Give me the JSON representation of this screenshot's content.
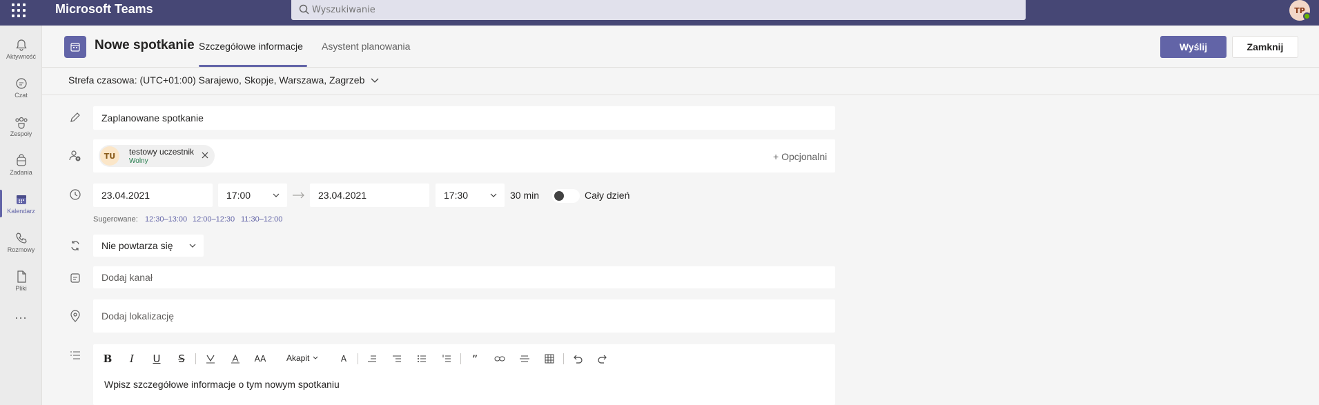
{
  "app": {
    "title": "Microsoft Teams",
    "user_initials": "TP"
  },
  "search": {
    "placeholder": "Wyszukiwanie"
  },
  "rail": {
    "items": [
      {
        "label": "Aktywność",
        "icon": "bell-icon"
      },
      {
        "label": "Czat",
        "icon": "chat-icon"
      },
      {
        "label": "Zespoły",
        "icon": "teams-icon"
      },
      {
        "label": "Zadania",
        "icon": "tasks-icon"
      },
      {
        "label": "Kalendarz",
        "icon": "calendar-icon",
        "active": true
      },
      {
        "label": "Rozmowy",
        "icon": "phone-icon"
      },
      {
        "label": "Pliki",
        "icon": "file-icon"
      }
    ],
    "more": "..."
  },
  "header": {
    "title": "Nowe spotkanie",
    "tabs": [
      {
        "label": "Szczegółowe informacje",
        "active": true
      },
      {
        "label": "Asystent planowania",
        "active": false
      }
    ],
    "send_label": "Wyślij",
    "close_label": "Zamknij"
  },
  "form": {
    "timezone": "Strefa czasowa: (UTC+01:00) Sarajewo, Skopje, Warszawa, Zagrzeb",
    "title_value": "Zaplanowane spotkanie",
    "attendee": {
      "initials": "TU",
      "name": "testowy uczestnik",
      "status": "Wolny"
    },
    "optional_label": "+ Opcjonalni",
    "start_date": "23.04.2021",
    "start_time": "17:00",
    "end_date": "23.04.2021",
    "end_time": "17:30",
    "duration": "30 min",
    "all_day_label": "Cały dzień",
    "all_day_on": false,
    "suggested_label": "Sugerowane:",
    "suggestions": [
      "12:30–13:00",
      "12:00–12:30",
      "11:30–12:00"
    ],
    "repeat": "Nie powtarza się",
    "channel_placeholder": "Dodaj kanał",
    "location_placeholder": "Dodaj lokalizację",
    "editor": {
      "paragraph_label": "Akapit",
      "placeholder": "Wpisz szczegółowe informacje o tym nowym spotkaniu"
    }
  },
  "colors": {
    "brand": "#464775",
    "accent": "#6264a7",
    "available": "#237b4b"
  }
}
